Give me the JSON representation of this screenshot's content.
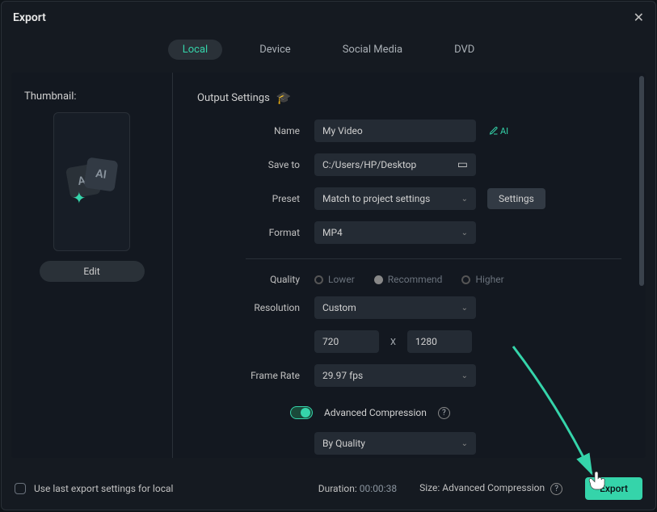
{
  "header": {
    "title": "Export"
  },
  "tabs": [
    "Local",
    "Device",
    "Social Media",
    "DVD"
  ],
  "active_tab": 0,
  "thumbnail": {
    "label": "Thumbnail:",
    "edit": "Edit"
  },
  "output": {
    "section": "Output Settings",
    "name_label": "Name",
    "name_value": "My Video",
    "ai": "AI",
    "save_label": "Save to",
    "save_value": "C:/Users/HP/Desktop",
    "preset_label": "Preset",
    "preset_value": "Match to project settings",
    "settings": "Settings",
    "format_label": "Format",
    "format_value": "MP4",
    "quality_label": "Quality",
    "quality_opts": [
      "Lower",
      "Recommend",
      "Higher"
    ],
    "quality_selected": 1,
    "resolution_label": "Resolution",
    "resolution_value": "Custom",
    "res_w": "720",
    "res_h": "1280",
    "res_x": "X",
    "frame_label": "Frame Rate",
    "frame_value": "29.97 fps",
    "adv_label": "Advanced Compression",
    "comp_value": "By Quality"
  },
  "footer": {
    "uselast": "Use last export settings for local",
    "duration_label": "Duration:",
    "duration_value": "00:00:38",
    "size_label": "Size:",
    "size_value": "Advanced Compression",
    "export": "Export"
  }
}
